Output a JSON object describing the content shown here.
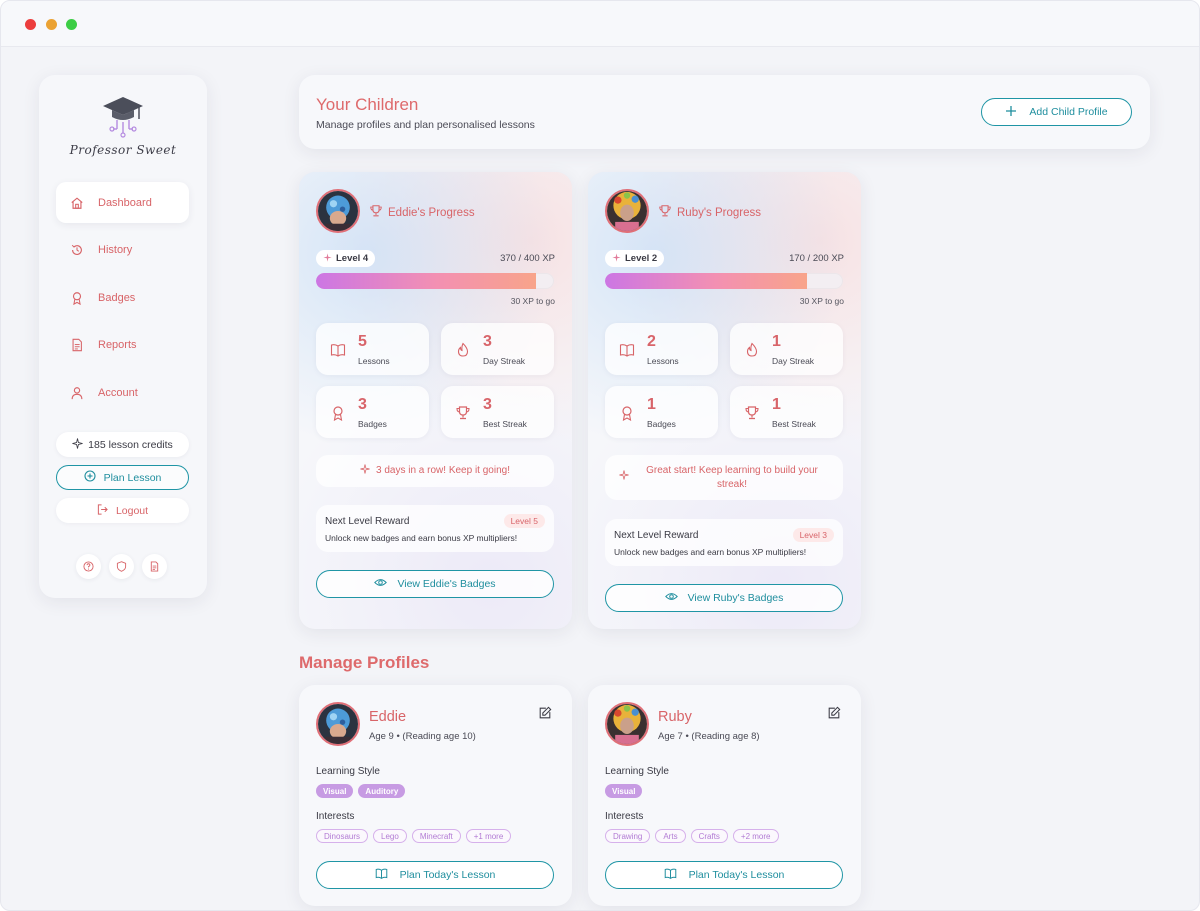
{
  "window": {
    "controls": [
      "close",
      "minimize",
      "maximize"
    ]
  },
  "sidebar": {
    "logo_text": "Professor Sweet",
    "nav": [
      {
        "label": "Dashboard",
        "icon": "home-icon",
        "active": true
      },
      {
        "label": "History",
        "icon": "history-icon"
      },
      {
        "label": "Badges",
        "icon": "badge-icon"
      },
      {
        "label": "Reports",
        "icon": "report-icon"
      },
      {
        "label": "Account",
        "icon": "user-icon"
      }
    ],
    "credits": "185 lesson credits",
    "plan_lesson": "Plan Lesson",
    "logout": "Logout",
    "footer_icons": [
      "help-icon",
      "shield-icon",
      "document-icon"
    ]
  },
  "header": {
    "title": "Your Children",
    "subtitle": "Manage profiles and plan personalised lessons",
    "add_button": "Add Child Profile"
  },
  "progress": [
    {
      "title": "Eddie's Progress",
      "level": "Level 4",
      "xp": "370 / 400 XP",
      "xp_fraction": 0.925,
      "to_go": "30 XP to go",
      "stats": [
        {
          "value": "5",
          "label": "Lessons"
        },
        {
          "value": "3",
          "label": "Day Streak"
        },
        {
          "value": "3",
          "label": "Badges"
        },
        {
          "value": "3",
          "label": "Best Streak"
        }
      ],
      "streak_message": "3 days in a row! Keep it going!",
      "reward_title": "Next Level Reward",
      "reward_level": "Level 5",
      "reward_desc": "Unlock new badges and earn bonus XP multipliers!",
      "view_button": "View Eddie's Badges"
    },
    {
      "title": "Ruby's Progress",
      "level": "Level 2",
      "xp": "170 / 200 XP",
      "xp_fraction": 0.85,
      "to_go": "30 XP to go",
      "stats": [
        {
          "value": "2",
          "label": "Lessons"
        },
        {
          "value": "1",
          "label": "Day Streak"
        },
        {
          "value": "1",
          "label": "Badges"
        },
        {
          "value": "1",
          "label": "Best Streak"
        }
      ],
      "streak_message": "Great start! Keep learning to build your streak!",
      "reward_title": "Next Level Reward",
      "reward_level": "Level 3",
      "reward_desc": "Unlock new badges and earn bonus XP multipliers!",
      "view_button": "View Ruby's Badges"
    }
  ],
  "manage": {
    "title": "Manage Profiles",
    "profiles": [
      {
        "name": "Eddie",
        "age": "Age 9 • (Reading age 10)",
        "learning_style_label": "Learning Style",
        "styles": [
          "Visual",
          "Auditory"
        ],
        "interests_label": "Interests",
        "interests": [
          "Dinosaurs",
          "Lego",
          "Minecraft",
          "+1 more"
        ],
        "plan_button": "Plan Today's Lesson"
      },
      {
        "name": "Ruby",
        "age": "Age 7 • (Reading age 8)",
        "learning_style_label": "Learning Style",
        "styles": [
          "Visual"
        ],
        "interests_label": "Interests",
        "interests": [
          "Drawing",
          "Arts",
          "Crafts",
          "+2 more"
        ],
        "plan_button": "Plan Today's Lesson"
      }
    ]
  },
  "colors": {
    "accent_coral": "#de6a6c",
    "accent_teal": "#1f95a5",
    "chip_purple": "#c79be3"
  }
}
